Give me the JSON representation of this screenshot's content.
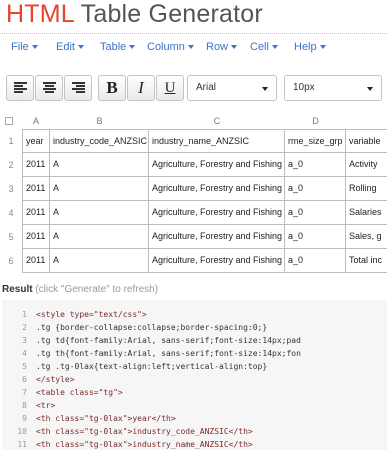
{
  "title": {
    "prefix": "HTML",
    "rest": "Table Generator"
  },
  "menu": [
    "File",
    "Edit",
    "Table",
    "Column",
    "Row",
    "Cell",
    "Help"
  ],
  "toolbar": {
    "bold": "B",
    "italic": "I",
    "underline": "U",
    "font": "Arial",
    "size": "10px"
  },
  "grid": {
    "col_letters": [
      "A",
      "B",
      "C",
      "D"
    ],
    "rows": [
      {
        "n": "1",
        "cells": [
          "year",
          "industry_code_ANZSIC",
          "industry_name_ANZSIC",
          "rme_size_grp",
          "variable"
        ]
      },
      {
        "n": "2",
        "cells": [
          "2011",
          "A",
          "Agriculture, Forestry and Fishing",
          "a_0",
          "Activity"
        ]
      },
      {
        "n": "3",
        "cells": [
          "2011",
          "A",
          "Agriculture, Forestry and Fishing",
          "a_0",
          "Rolling"
        ]
      },
      {
        "n": "4",
        "cells": [
          "2011",
          "A",
          "Agriculture, Forestry and Fishing",
          "a_0",
          "Salaries"
        ]
      },
      {
        "n": "5",
        "cells": [
          "2011",
          "A",
          "Agriculture, Forestry and Fishing",
          "a_0",
          "Sales, g"
        ]
      },
      {
        "n": "6",
        "cells": [
          "2011",
          "A",
          "Agriculture, Forestry and Fishing",
          "a_0",
          "Total inc"
        ]
      }
    ]
  },
  "result": {
    "label": "Result",
    "hint": "(click \"Generate\" to refresh)"
  },
  "code_lines": [
    {
      "n": "1",
      "text": "<style type=\"text/css\">"
    },
    {
      "n": "2",
      "text": ".tg  {border-collapse:collapse;border-spacing:0;}"
    },
    {
      "n": "3",
      "text": ".tg td{font-family:Arial, sans-serif;font-size:14px;pad"
    },
    {
      "n": "4",
      "text": ".tg th{font-family:Arial, sans-serif;font-size:14px;fon"
    },
    {
      "n": "5",
      "text": ".tg .tg-0lax{text-align:left;vertical-align:top}"
    },
    {
      "n": "6",
      "text": "</style>"
    },
    {
      "n": "7",
      "text": "<table class=\"tg\">"
    },
    {
      "n": "8",
      "text": "  <tr>"
    },
    {
      "n": "9",
      "text": "    <th class=\"tg-0lax\">year</th>"
    },
    {
      "n": "10",
      "text": "    <th class=\"tg-0lax\">industry_code_ANZSIC</th>"
    },
    {
      "n": "11",
      "text": "    <th class=\"tg-0lax\">industry_name_ANZSIC</th>"
    }
  ]
}
